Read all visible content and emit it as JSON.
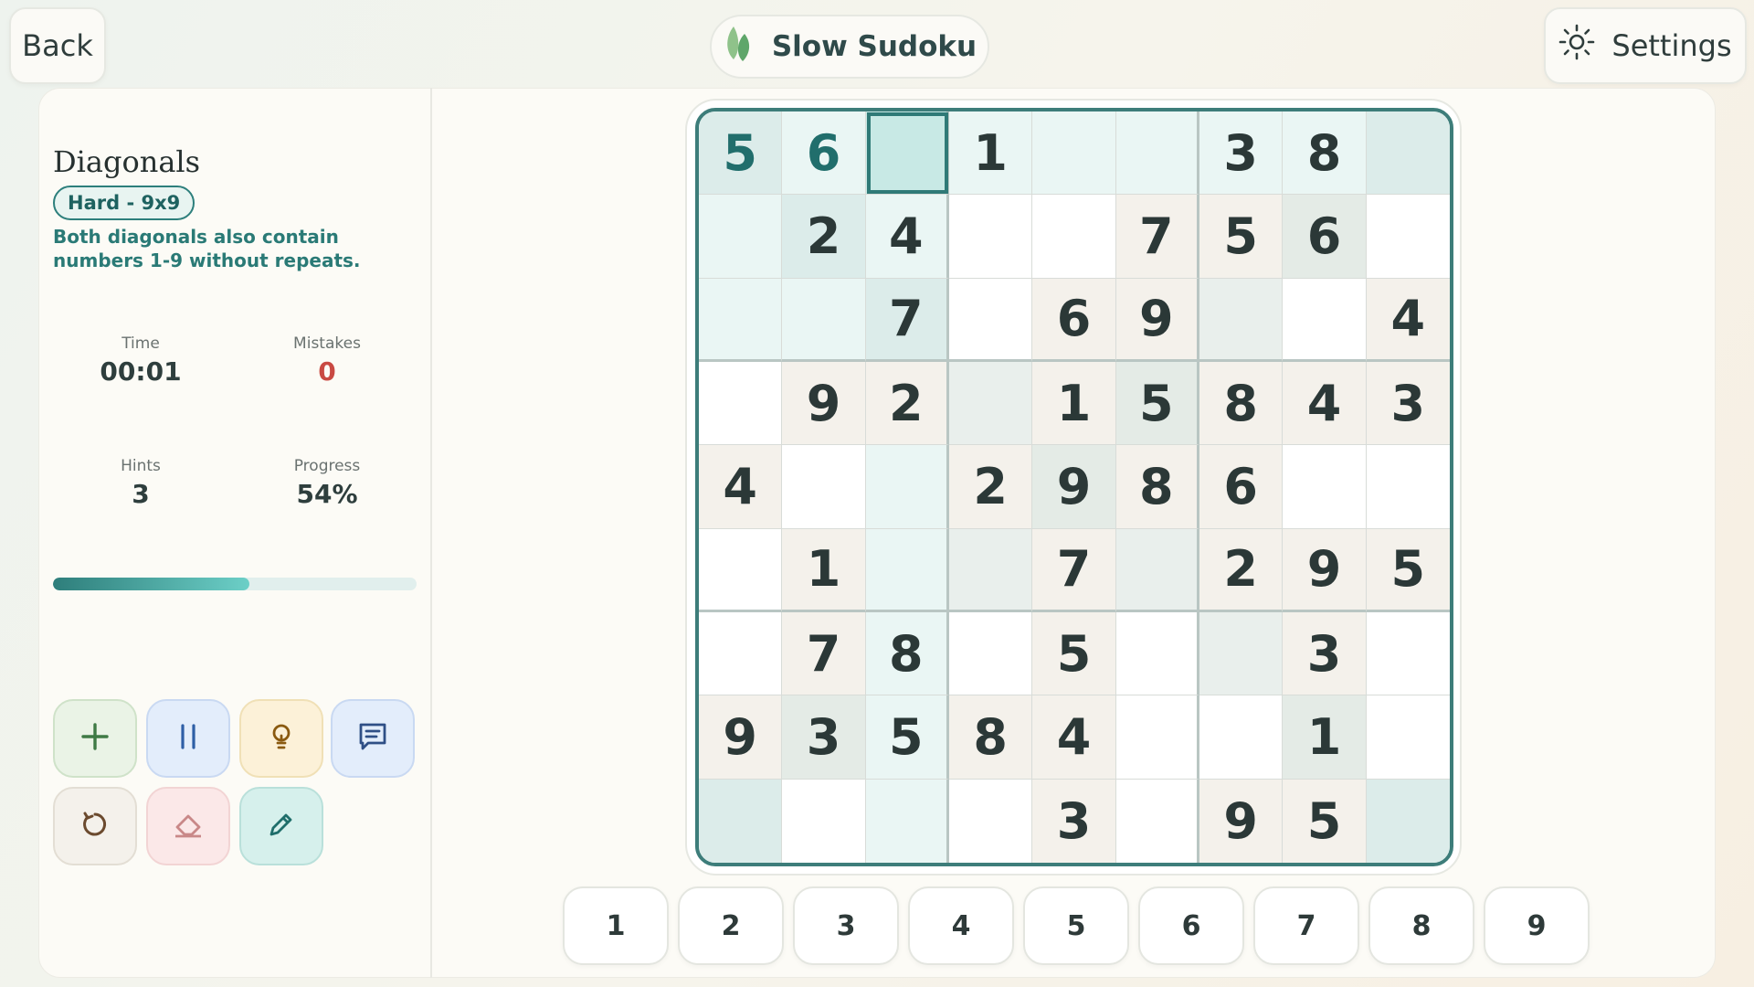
{
  "header": {
    "back_label": "Back",
    "title": "Slow Sudoku",
    "settings_label": "Settings"
  },
  "sidebar": {
    "mode_title": "Diagonals",
    "difficulty_badge": "Hard - 9x9",
    "description": "Both diagonals also contain numbers 1-9 without repeats.",
    "stats": {
      "time_label": "Time",
      "time_value": "00:01",
      "mistakes_label": "Mistakes",
      "mistakes_value": "0",
      "hints_label": "Hints",
      "hints_value": "3",
      "progress_label": "Progress",
      "progress_value": "54%"
    },
    "progress_fraction": 0.54,
    "tools": [
      "plus-icon",
      "pause-icon",
      "lightbulb-icon",
      "notes-icon",
      "undo-icon",
      "eraser-icon",
      "pencil-icon"
    ]
  },
  "board": {
    "rows": [
      [
        "5",
        "6",
        "",
        "1",
        "",
        "",
        "3",
        "8",
        ""
      ],
      [
        "",
        "2",
        "4",
        "",
        "",
        "7",
        "5",
        "6",
        ""
      ],
      [
        "",
        "",
        "7",
        "",
        "6",
        "9",
        "",
        "",
        "4"
      ],
      [
        "",
        "9",
        "2",
        "",
        "1",
        "5",
        "8",
        "4",
        "3"
      ],
      [
        "4",
        "",
        "",
        "2",
        "9",
        "8",
        "6",
        "",
        ""
      ],
      [
        "",
        "1",
        "",
        "",
        "7",
        "",
        "2",
        "9",
        "5"
      ],
      [
        "",
        "7",
        "8",
        "",
        "5",
        "",
        "",
        "3",
        ""
      ],
      [
        "9",
        "3",
        "5",
        "8",
        "4",
        "",
        "",
        "1",
        ""
      ],
      [
        "",
        "",
        "",
        "",
        "3",
        "",
        "9",
        "5",
        ""
      ]
    ],
    "selected": {
      "row": 0,
      "col": 2
    }
  },
  "numpad": [
    "1",
    "2",
    "3",
    "4",
    "5",
    "6",
    "7",
    "8",
    "9"
  ],
  "colors": {
    "accent": "#2f7a77",
    "cell_white": "#ffffff",
    "cell_cream": "#f4f1eb",
    "cell_lightteal": "#eaf6f4",
    "cell_mint": "#dcecea",
    "cell_sage": "#e4ebe6",
    "cell_selected": "#c8e9e5"
  }
}
